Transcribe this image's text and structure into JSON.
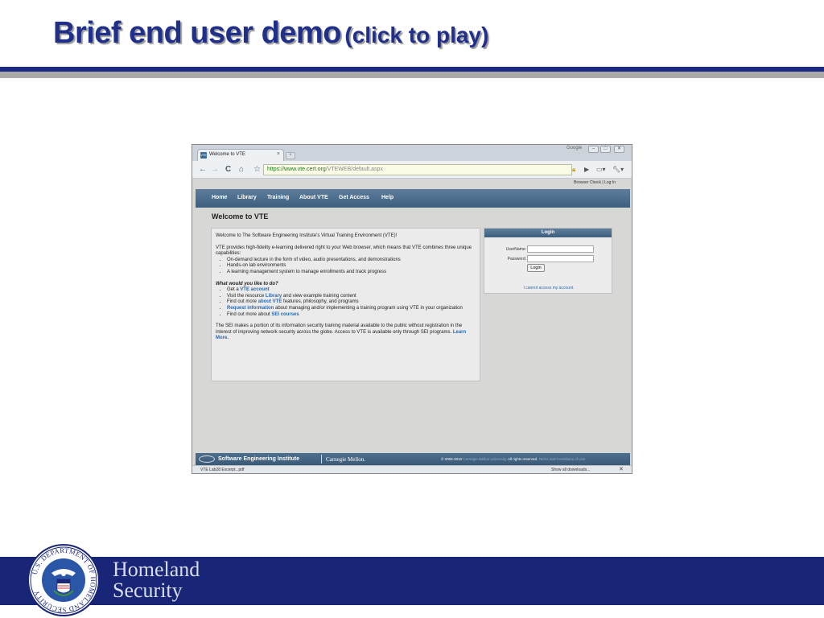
{
  "slide": {
    "title_main": "Brief end user demo",
    "title_sub": "(click to play)",
    "org_line1": "Homeland",
    "org_line2": "Security",
    "seal_text": "U.S. DEPARTMENT OF HOMELAND SECURITY"
  },
  "browser": {
    "tab_title": "Welcome to VTE",
    "tab_favicon": "VTE",
    "tab_close": "×",
    "window_label": "Google",
    "url_secure": "https://www.vte.cert.org",
    "url_path": "/VTEWEB/default.aspx",
    "nav_icons": [
      "back-icon",
      "forward-icon",
      "reload-icon",
      "home-icon",
      "star-icon"
    ],
    "download_file": "VTE Lab28 Excerpt...pdf",
    "download_show_all": "Show all downloads...",
    "download_close": "✕"
  },
  "site": {
    "toplinks": "Browser Check  |  Log In",
    "nav": [
      "Home",
      "Library",
      "Training",
      "About VTE",
      "Get Access",
      "Help"
    ],
    "page_heading": "Welcome to VTE",
    "intro": "Welcome to The Software Engineering Institute's Virtual Training Environment (VTE)!",
    "provides": "VTE provides high-fidelity e-learning delivered right to your Web browser, which means that VTE combines three unique capabilities:",
    "capabilities": [
      "On-demand lecture in the form of video, audio presentations, and demonstrations",
      "Hands-on lab environments",
      "A learning management system to manage enrollments and track progress"
    ],
    "question": "What would you like to do?",
    "actions": {
      "a1_pre": "Get a ",
      "a1_link": "VTE account",
      "a2_pre": "Visit the resource ",
      "a2_link": "Library",
      "a2_post": " and view example training content",
      "a3_pre": "Find out more ",
      "a3_link": "about VTE",
      "a3_post": " features, philosophy, and programs",
      "a4_link": "Request information",
      "a4_post": " about managing and/or implementing a training program using VTE in your organization",
      "a5_pre": "Find out more about ",
      "a5_link": "SEI courses"
    },
    "closing": "The SEI makes a portion of its information security training material available to the public without registration in the interest of improving network security across the globe. Access to VTE is available only through SEI programs. ",
    "closing_link": "Learn More."
  },
  "login": {
    "title": "Login",
    "username_label": "UserName:",
    "password_label": "Password:",
    "username_value": "",
    "password_value": "",
    "button": "Login",
    "help_link": "I cannot access my account."
  },
  "footer": {
    "sei": "Software Engineering Institute",
    "cmu": "Carnegie Mellon.",
    "copy_pre": "© 2006-2010 ",
    "copy_cmu": "Carnegie Mellon University.",
    "copy_rights": " All rights reserved. ",
    "copy_terms": "Terms and Conditions of Use"
  },
  "colors": {
    "title": "#1f2f8a",
    "band": "#192677",
    "site_nav": "#3d5f7e",
    "link": "#2a6aaf"
  }
}
